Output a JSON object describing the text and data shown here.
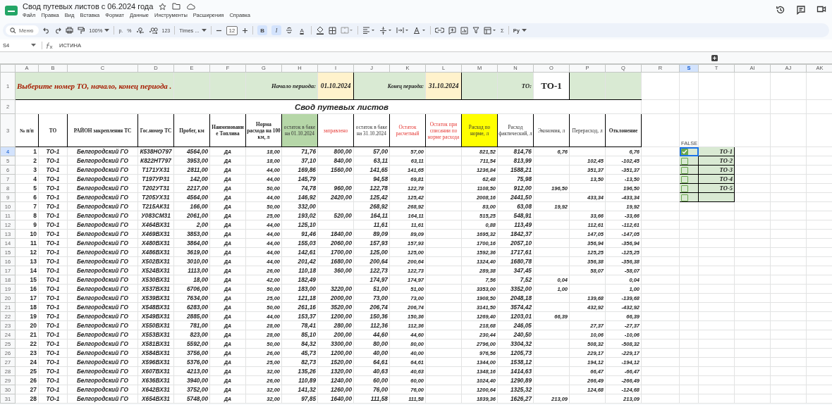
{
  "doc": {
    "title": "Свод путевых листов с 06.2024 года"
  },
  "menu": [
    "Файл",
    "Правка",
    "Вид",
    "Вставка",
    "Формат",
    "Данные",
    "Инструменты",
    "Расширения",
    "Справка"
  ],
  "toolbar": {
    "search": "Меню",
    "zoom": "100%",
    "currency": "р.",
    "percent": "%",
    "number_format": "123",
    "font": "Times ...",
    "font_size": "12",
    "bold": "B",
    "italic": "I",
    "text_color": "A",
    "sum": "Σ",
    "input": "Pу"
  },
  "formula_bar": {
    "cell": "S4",
    "formula": "ИСТИНА"
  },
  "columns": [
    {
      "letter": "A",
      "selected": false
    },
    {
      "letter": "B",
      "selected": false
    },
    {
      "letter": "C",
      "selected": false
    },
    {
      "letter": "D",
      "selected": false
    },
    {
      "letter": "E",
      "selected": false
    },
    {
      "letter": "F",
      "selected": false
    },
    {
      "letter": "G",
      "selected": false
    },
    {
      "letter": "H",
      "selected": false
    },
    {
      "letter": "I",
      "selected": false
    },
    {
      "letter": "J",
      "selected": false
    },
    {
      "letter": "K",
      "selected": false
    },
    {
      "letter": "L",
      "selected": false
    },
    {
      "letter": "M",
      "selected": false
    },
    {
      "letter": "N",
      "selected": false
    },
    {
      "letter": "O",
      "selected": false
    },
    {
      "letter": "P",
      "selected": false
    },
    {
      "letter": "Q",
      "selected": false
    },
    {
      "letter": "R",
      "selected": false
    },
    {
      "letter": "S",
      "selected": true
    },
    {
      "letter": "T",
      "selected": false
    },
    {
      "letter": "AI",
      "selected": false
    },
    {
      "letter": "AJ",
      "selected": false
    },
    {
      "letter": "AK",
      "selected": false
    }
  ],
  "banner": {
    "row": "1",
    "prompt": "Выберите номер ТО, начало, конец периода .",
    "start_label": "Начало периода:",
    "start_date": "01.10.2024",
    "end_label": "Конец периода:",
    "end_date": "31.10.2024",
    "to_label": "ТО:",
    "to_value": "ТО-1"
  },
  "caption": {
    "row": "2",
    "text": "Свод путевых листов"
  },
  "header": {
    "row": "3",
    "side_label": "FALSE",
    "headings": [
      {
        "text": "№ п/п",
        "kind": "bold"
      },
      {
        "text": "ТО",
        "kind": "bold"
      },
      {
        "text": "РАЙОН закрепления ТС",
        "kind": "bold"
      },
      {
        "text": "Гос.номер ТС",
        "kind": "bold"
      },
      {
        "text": "Пробег, км",
        "kind": "bold"
      },
      {
        "text": "Наименование Топлива",
        "kind": "bold"
      },
      {
        "text": "Норма расхода на 100 км, л",
        "kind": "bold"
      },
      {
        "text": "остаток в баке на 01.10.2024",
        "kind": "plain",
        "color": "#b6d7a8"
      },
      {
        "text": "заправлено",
        "kind": "red"
      },
      {
        "text": "остаток в баке на 31.10.2024",
        "kind": "plain"
      },
      {
        "text": "Остаток расчетный",
        "kind": "red"
      },
      {
        "text": "Остаток при списании по норме расхода",
        "kind": "red"
      },
      {
        "text": "Расход по норме, л",
        "kind": "plain",
        "color": "#ffff00"
      },
      {
        "text": "Расход фактический, л",
        "kind": "plain"
      },
      {
        "text": "Экономия, л",
        "kind": "plain"
      },
      {
        "text": "Перерасход, л",
        "kind": "plain"
      },
      {
        "text": "Отклонение",
        "kind": "bold"
      }
    ]
  },
  "rows": [
    {
      "row": "4",
      "selected": true,
      "n": "1",
      "to": "ТО-1",
      "district": "Белгородский ГО",
      "plate": "К538НО797",
      "km": "4564,00",
      "fuel": "ДА",
      "norm": "18,00",
      "start": "71,76",
      "refuel": "800,00",
      "end": "57,00",
      "calc": "57,00",
      "norm_use": "821,52",
      "actual": "814,76",
      "saving": "6,76",
      "dev": "6,76"
    },
    {
      "row": "5",
      "selected": false,
      "n": "2",
      "to": "ТО-1",
      "district": "Белгородский ГО",
      "plate": "К822НТ797",
      "km": "3953,00",
      "fuel": "ДА",
      "norm": "18,00",
      "start": "37,10",
      "refuel": "840,00",
      "end": "63,11",
      "calc": "63,11",
      "norm_use": "711,54",
      "actual": "813,99",
      "overuse": "102,45",
      "dev": "-102,45"
    },
    {
      "row": "6",
      "selected": false,
      "n": "3",
      "to": "ТО-1",
      "district": "Белгородский ГО",
      "plate": "Т171УХ31",
      "km": "2811,00",
      "fuel": "ДА",
      "norm": "44,00",
      "start": "169,86",
      "refuel": "1560,00",
      "end": "141,65",
      "calc": "141,65",
      "norm_use": "1236,84",
      "actual": "1588,21",
      "overuse": "351,37",
      "dev": "-351,37"
    },
    {
      "row": "7",
      "selected": false,
      "n": "4",
      "to": "ТО-1",
      "district": "Белгородский ГО",
      "plate": "Т197УР31",
      "km": "142,00",
      "fuel": "ДА",
      "norm": "44,00",
      "start": "145,79",
      "end": "94,58",
      "calc": "69,81",
      "norm_use": "62,48",
      "actual": "75,98",
      "overuse": "13,50",
      "dev": "-13,50"
    },
    {
      "row": "8",
      "selected": false,
      "n": "5",
      "to": "ТО-1",
      "district": "Белгородский ГО",
      "plate": "Т202УТ31",
      "km": "2217,00",
      "fuel": "ДА",
      "norm": "50,00",
      "start": "74,78",
      "refuel": "960,00",
      "end": "122,78",
      "calc": "122,78",
      "norm_use": "1108,50",
      "actual": "912,00",
      "saving": "196,50",
      "dev": "196,50"
    },
    {
      "row": "9",
      "selected": false,
      "n": "6",
      "to": "ТО-1",
      "district": "Белгородский ГО",
      "plate": "Т205УХ31",
      "km": "4564,00",
      "fuel": "ДА",
      "norm": "44,00",
      "start": "146,92",
      "refuel": "2420,00",
      "end": "125,42",
      "calc": "125,42",
      "norm_use": "2008,16",
      "actual": "2441,50",
      "overuse": "433,34",
      "dev": "-433,34"
    },
    {
      "row": "10",
      "selected": false,
      "n": "7",
      "to": "ТО-1",
      "district": "Белгородский ГО",
      "plate": "Т215АК31",
      "km": "166,00",
      "fuel": "ДА",
      "norm": "50,00",
      "start": "332,00",
      "end": "268,92",
      "calc": "268,92",
      "norm_use": "83,00",
      "actual": "63,08",
      "saving": "19,92",
      "dev": "19,92"
    },
    {
      "row": "11",
      "selected": false,
      "n": "8",
      "to": "ТО-1",
      "district": "Белгородский ГО",
      "plate": "У083СМ31",
      "km": "2061,00",
      "fuel": "ДА",
      "norm": "25,00",
      "start": "193,02",
      "refuel": "520,00",
      "end": "164,11",
      "calc": "164,11",
      "norm_use": "515,25",
      "actual": "548,91",
      "overuse": "33,66",
      "dev": "-33,66"
    },
    {
      "row": "12",
      "selected": false,
      "n": "9",
      "to": "ТО-1",
      "district": "Белгородский ГО",
      "plate": "Х464ВХ31",
      "km": "2,00",
      "fuel": "ДА",
      "norm": "44,00",
      "start": "125,10",
      "end": "11,61",
      "calc": "11,61",
      "norm_use": "0,88",
      "actual": "113,49",
      "overuse": "112,61",
      "dev": "-112,61"
    },
    {
      "row": "13",
      "selected": false,
      "n": "10",
      "to": "ТО-1",
      "district": "Белгородский ГО",
      "plate": "Х469ВХ31",
      "km": "3853,00",
      "fuel": "ДА",
      "norm": "44,00",
      "start": "91,46",
      "refuel": "1840,00",
      "end": "89,09",
      "calc": "89,09",
      "norm_use": "1695,32",
      "actual": "1842,37",
      "overuse": "147,05",
      "dev": "-147,05"
    },
    {
      "row": "14",
      "selected": false,
      "n": "11",
      "to": "ТО-1",
      "district": "Белгородский ГО",
      "plate": "Х480ВХ31",
      "km": "3864,00",
      "fuel": "ДА",
      "norm": "44,00",
      "start": "155,03",
      "refuel": "2060,00",
      "end": "157,93",
      "calc": "157,93",
      "norm_use": "1700,16",
      "actual": "2057,10",
      "overuse": "356,94",
      "dev": "-356,94"
    },
    {
      "row": "15",
      "selected": false,
      "n": "12",
      "to": "ТО-1",
      "district": "Белгородский ГО",
      "plate": "Х486ВХ31",
      "km": "3619,00",
      "fuel": "ДА",
      "norm": "44,00",
      "start": "142,61",
      "refuel": "1700,00",
      "end": "125,00",
      "calc": "125,00",
      "norm_use": "1592,36",
      "actual": "1717,61",
      "overuse": "125,25",
      "dev": "-125,25"
    },
    {
      "row": "16",
      "selected": false,
      "n": "13",
      "to": "ТО-1",
      "district": "Белгородский ГО",
      "plate": "Х502ВХ31",
      "km": "3010,00",
      "fuel": "ДА",
      "norm": "44,00",
      "start": "201,42",
      "refuel": "1680,00",
      "end": "200,64",
      "calc": "200,64",
      "norm_use": "1324,40",
      "actual": "1680,78",
      "overuse": "356,38",
      "dev": "-356,38"
    },
    {
      "row": "17",
      "selected": false,
      "n": "14",
      "to": "ТО-1",
      "district": "Белгородский ГО",
      "plate": "Х524ВХ31",
      "km": "1113,00",
      "fuel": "ДА",
      "norm": "26,00",
      "start": "110,18",
      "refuel": "360,00",
      "end": "122,73",
      "calc": "122,73",
      "norm_use": "289,38",
      "actual": "347,45",
      "overuse": "58,07",
      "dev": "-58,07"
    },
    {
      "row": "18",
      "selected": false,
      "n": "15",
      "to": "ТО-1",
      "district": "Белгородский ГО",
      "plate": "Х530ВХ31",
      "km": "18,00",
      "fuel": "ДА",
      "norm": "42,00",
      "start": "182,49",
      "end": "174,97",
      "calc": "174,97",
      "norm_use": "7,56",
      "actual": "7,52",
      "saving": "0,04",
      "dev": "0,04"
    },
    {
      "row": "19",
      "selected": false,
      "n": "16",
      "to": "ТО-1",
      "district": "Белгородский ГО",
      "plate": "Х537ВХ31",
      "km": "6706,00",
      "fuel": "ДА",
      "norm": "50,00",
      "start": "183,00",
      "refuel": "3220,00",
      "end": "51,00",
      "calc": "51,00",
      "norm_use": "3353,00",
      "actual": "3352,00",
      "saving": "1,00",
      "dev": "1,00"
    },
    {
      "row": "20",
      "selected": false,
      "n": "17",
      "to": "ТО-1",
      "district": "Белгородский ГО",
      "plate": "Х539ВХ31",
      "km": "7634,00",
      "fuel": "ДА",
      "norm": "25,00",
      "start": "121,18",
      "refuel": "2000,00",
      "end": "73,00",
      "calc": "73,00",
      "norm_use": "1908,50",
      "actual": "2048,18",
      "overuse": "139,68",
      "dev": "-139,68"
    },
    {
      "row": "21",
      "selected": false,
      "n": "18",
      "to": "ТО-1",
      "district": "Белгородский ГО",
      "plate": "Х548ВХ31",
      "km": "6283,00",
      "fuel": "ДА",
      "norm": "50,00",
      "start": "261,16",
      "refuel": "3520,00",
      "end": "206,74",
      "calc": "206,74",
      "norm_use": "3141,50",
      "actual": "3574,42",
      "overuse": "432,92",
      "dev": "-432,92"
    },
    {
      "row": "22",
      "selected": false,
      "n": "19",
      "to": "ТО-1",
      "district": "Белгородский ГО",
      "plate": "Х549ВХ31",
      "km": "2885,00",
      "fuel": "ДА",
      "norm": "44,00",
      "start": "153,37",
      "refuel": "1200,00",
      "end": "150,36",
      "calc": "150,36",
      "norm_use": "1269,40",
      "actual": "1203,01",
      "saving": "66,39",
      "dev": "66,39"
    },
    {
      "row": "23",
      "selected": false,
      "n": "20",
      "to": "ТО-1",
      "district": "Белгородский ГО",
      "plate": "Х550ВХ31",
      "km": "781,00",
      "fuel": "ДА",
      "norm": "28,00",
      "start": "78,41",
      "refuel": "280,00",
      "end": "112,36",
      "calc": "112,36",
      "norm_use": "218,68",
      "actual": "246,05",
      "overuse": "27,37",
      "dev": "-27,37"
    },
    {
      "row": "24",
      "selected": false,
      "n": "21",
      "to": "ТО-1",
      "district": "Белгородский ГО",
      "plate": "Х553ВХ31",
      "km": "823,00",
      "fuel": "ДА",
      "norm": "28,00",
      "start": "85,10",
      "refuel": "200,00",
      "end": "44,60",
      "calc": "44,60",
      "norm_use": "230,44",
      "actual": "240,50",
      "overuse": "10,06",
      "dev": "-10,06"
    },
    {
      "row": "25",
      "selected": false,
      "n": "22",
      "to": "ТО-1",
      "district": "Белгородский ГО",
      "plate": "Х581ВХ31",
      "km": "5592,00",
      "fuel": "ДА",
      "norm": "50,00",
      "start": "84,32",
      "refuel": "3300,00",
      "end": "80,00",
      "calc": "80,00",
      "norm_use": "2796,00",
      "actual": "3304,32",
      "overuse": "508,32",
      "dev": "-508,32"
    },
    {
      "row": "26",
      "selected": false,
      "n": "23",
      "to": "ТО-1",
      "district": "Белгородский ГО",
      "plate": "Х584ВХ31",
      "km": "3756,00",
      "fuel": "ДА",
      "norm": "26,00",
      "start": "45,73",
      "refuel": "1200,00",
      "end": "40,00",
      "calc": "40,00",
      "norm_use": "976,56",
      "actual": "1205,73",
      "overuse": "229,17",
      "dev": "-229,17"
    },
    {
      "row": "27",
      "selected": false,
      "n": "24",
      "to": "ТО-1",
      "district": "Белгородский ГО",
      "plate": "Х596ВХ31",
      "km": "5376,00",
      "fuel": "ДА",
      "norm": "25,00",
      "start": "82,73",
      "refuel": "1520,00",
      "end": "64,61",
      "calc": "64,61",
      "norm_use": "1344,00",
      "actual": "1538,12",
      "overuse": "194,12",
      "dev": "-194,12"
    },
    {
      "row": "28",
      "selected": false,
      "n": "25",
      "to": "ТО-1",
      "district": "Белгородский ГО",
      "plate": "Х607ВХ31",
      "km": "4213,00",
      "fuel": "ДА",
      "norm": "32,00",
      "start": "135,26",
      "refuel": "1320,00",
      "end": "40,63",
      "calc": "40,63",
      "norm_use": "1348,16",
      "actual": "1414,63",
      "overuse": "66,47",
      "dev": "-66,47"
    },
    {
      "row": "29",
      "selected": false,
      "n": "26",
      "to": "ТО-1",
      "district": "Белгородский ГО",
      "plate": "Х636ВХ31",
      "km": "3940,00",
      "fuel": "ДА",
      "norm": "26,00",
      "start": "110,89",
      "refuel": "1240,00",
      "end": "60,00",
      "calc": "60,00",
      "norm_use": "1024,40",
      "actual": "1290,89",
      "overuse": "266,49",
      "dev": "-266,49"
    },
    {
      "row": "30",
      "selected": false,
      "n": "27",
      "to": "ТО-1",
      "district": "Белгородский ГО",
      "plate": "Х642ВХ31",
      "km": "3752,00",
      "fuel": "ДА",
      "norm": "32,00",
      "start": "141,32",
      "refuel": "1260,00",
      "end": "76,00",
      "calc": "76,00",
      "norm_use": "1200,64",
      "actual": "1325,32",
      "overuse": "124,68",
      "dev": "-124,68"
    },
    {
      "row": "31",
      "selected": false,
      "n": "28",
      "to": "ТО-1",
      "district": "Белгородский ГО",
      "plate": "Х654ВХ31",
      "km": "5748,00",
      "fuel": "ДА",
      "norm": "32,00",
      "start": "97,85",
      "refuel": "1640,00",
      "end": "111,58",
      "calc": "111,58",
      "norm_use": "1839,36",
      "actual": "1626,27",
      "saving": "213,09",
      "dev": "213,09"
    }
  ],
  "side_list": {
    "items": [
      {
        "checked": true,
        "selected": true,
        "label": "ТО-1"
      },
      {
        "checked": false,
        "selected": false,
        "label": "ТО-2"
      },
      {
        "checked": false,
        "selected": false,
        "label": "ТО-3"
      },
      {
        "checked": false,
        "selected": false,
        "label": "ТО-4"
      },
      {
        "checked": false,
        "selected": false,
        "label": "ТО-5"
      },
      {
        "checked": false,
        "selected": false
      }
    ]
  }
}
